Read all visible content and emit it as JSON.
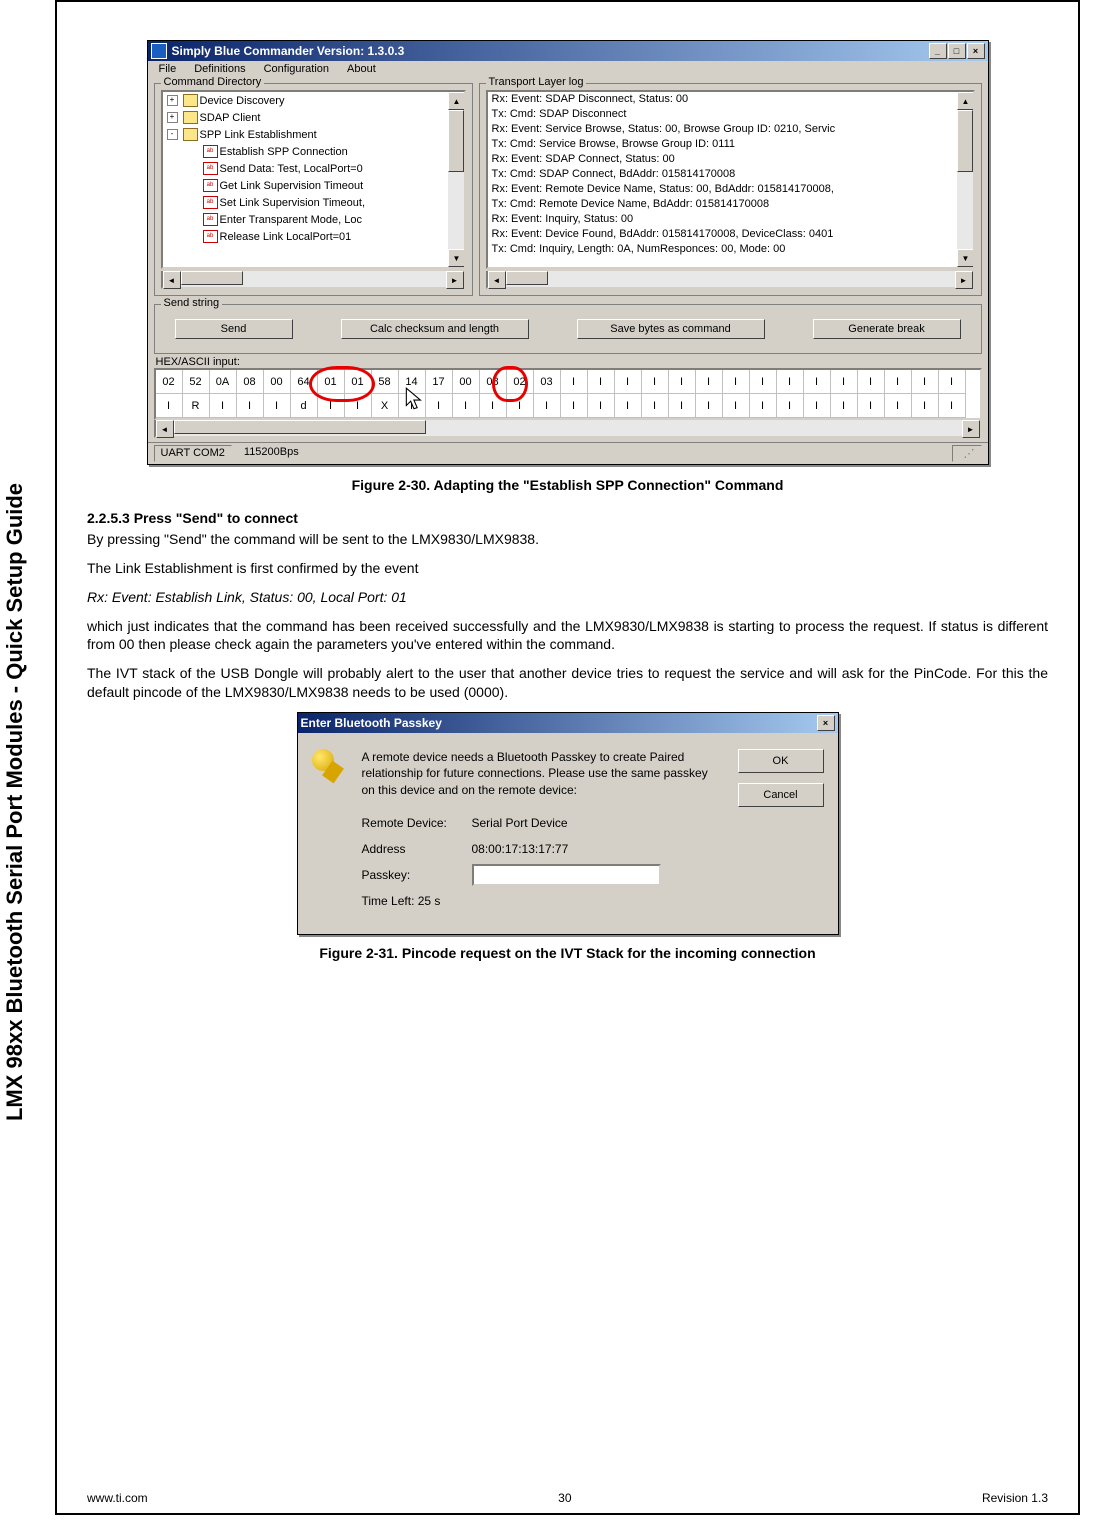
{
  "side_title": "LMX 98xx Bluetooth Serial Port Modules - Quick Setup Guide",
  "app": {
    "title": "Simply Blue Commander    Version: 1.3.0.3",
    "menu": [
      "File",
      "Definitions",
      "Configuration",
      "About"
    ],
    "cmd_legend": "Command Directory",
    "log_legend": "Transport Layer log",
    "tree": [
      {
        "lvl": 0,
        "type": "folder",
        "exp": "+",
        "label": "Device Discovery"
      },
      {
        "lvl": 0,
        "type": "folder",
        "exp": "+",
        "label": "SDAP Client"
      },
      {
        "lvl": 0,
        "type": "folder",
        "exp": "-",
        "label": "SPP Link Establishment"
      },
      {
        "lvl": 1,
        "type": "cmd",
        "label": "Establish SPP Connection"
      },
      {
        "lvl": 1,
        "type": "cmd",
        "label": "Send Data: Test, LocalPort=0"
      },
      {
        "lvl": 1,
        "type": "cmd",
        "label": "Get Link Supervision Timeout"
      },
      {
        "lvl": 1,
        "type": "cmd",
        "label": "Set Link Supervision Timeout,"
      },
      {
        "lvl": 1,
        "type": "cmd",
        "label": "Enter Transparent Mode, Loc"
      },
      {
        "lvl": 1,
        "type": "cmd",
        "label": "Release Link LocalPort=01"
      }
    ],
    "log": [
      "Rx: Event: SDAP Disconnect, Status: 00",
      "Tx: Cmd: SDAP Disconnect",
      "Rx: Event: Service Browse, Status: 00, Browse Group ID: 0210, Servic",
      "Tx: Cmd: Service Browse, Browse Group ID: 0111",
      "Rx: Event: SDAP Connect, Status: 00",
      "Tx: Cmd: SDAP Connect, BdAddr: 015814170008",
      "Rx: Event: Remote Device Name, Status: 00, BdAddr: 015814170008,",
      "Tx: Cmd: Remote Device Name, BdAddr: 015814170008",
      "Rx: Event: Inquiry, Status: 00",
      "Rx: Event: Device Found, BdAddr: 015814170008, DeviceClass: 0401",
      "Tx: Cmd: Inquiry, Length: 0A, NumResponces: 00, Mode: 00"
    ],
    "send_legend": "Send string",
    "buttons": {
      "send": "Send",
      "calc": "Calc checksum and length",
      "save": "Save bytes as command",
      "gen": "Generate break"
    },
    "hex_label": "HEX/ASCII input:",
    "hex_row1": [
      "02",
      "52",
      "0A",
      "08",
      "00",
      "64",
      "01",
      "01",
      "58",
      "14",
      "17",
      "00",
      "08",
      "02",
      "03",
      "I",
      "I",
      "I",
      "I",
      "I",
      "I",
      "I",
      "I",
      "I",
      "I",
      "I",
      "I",
      "I",
      "I",
      "I"
    ],
    "hex_row2": [
      "I",
      "R",
      "I",
      "I",
      "I",
      "d",
      "I",
      "I",
      "X",
      "I",
      "I",
      "I",
      "I",
      "I",
      "I",
      "I",
      "I",
      "I",
      "I",
      "I",
      "I",
      "I",
      "I",
      "I",
      "I",
      "I",
      "I",
      "I",
      "I",
      "I"
    ],
    "status1": "UART COM2",
    "status2": "115200Bps"
  },
  "fig30": "Figure 2-30.  Adapting the \"Establish SPP Connection\" Command",
  "section": {
    "heading": "2.2.5.3    Press \"Send\" to connect",
    "p1": "By pressing \"Send\" the command will be sent to the LMX9830/LMX9838.",
    "p2": "The Link Establishment is first confirmed by the event",
    "p3": "Rx: Event: Establish Link, Status: 00, Local Port: 01",
    "p4": "which just indicates that the command has been received successfully and the LMX9830/LMX9838 is starting to process the request. If status is different from 00 then please check again the parameters you've entered within the com­mand.",
    "p5": "The IVT stack of the USB Dongle will probably alert to the user that another device tries to request the service and will ask for the PinCode. For this the default pincode of the LMX9830/LMX9838 needs to be used (0000)."
  },
  "dialog": {
    "title": "Enter Bluetooth Passkey",
    "msg": "A remote device needs a Bluetooth Passkey to create Paired relationship for future connections. Please use the same passkey on this device and on the remote device:",
    "remote_lbl": "Remote Device:",
    "remote": "Serial Port Device",
    "addr_lbl": "Address",
    "addr": "08:00:17:13:17:77",
    "pass_lbl": "Passkey:",
    "time": "Time Left: 25 s",
    "ok": "OK",
    "cancel": "Cancel"
  },
  "fig31": "Figure 2-31.  Pincode request on the IVT Stack for the incoming connection",
  "footer": {
    "left": "www.ti.com",
    "mid": "30",
    "right": "Revision 1.3"
  }
}
